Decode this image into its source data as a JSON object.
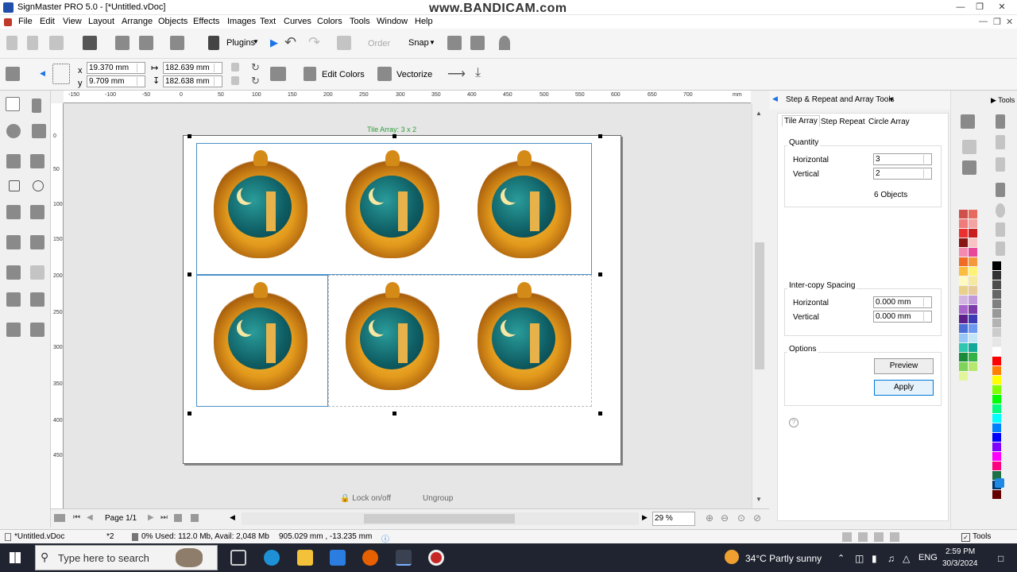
{
  "window": {
    "title": "SignMaster PRO 5.0 - [*Untitled.vDoc]",
    "watermark": "www.BANDICAM.com"
  },
  "menu": [
    "File",
    "Edit",
    "View",
    "Layout",
    "Arrange",
    "Objects",
    "Effects",
    "Images",
    "Text",
    "Curves",
    "Colors",
    "Tools",
    "Window",
    "Help"
  ],
  "toolbar": {
    "plugins": "Plugins",
    "order": "Order",
    "snap": "Snap",
    "x_label": "x",
    "y_label": "y",
    "x_value": "19.370 mm",
    "y_value": "9.709 mm",
    "width_value": "182.639 mm",
    "height_value": "182.638 mm",
    "edit_colors": "Edit Colors",
    "vectorize": "Vectorize"
  },
  "ruler": {
    "h_ticks": [
      "-150",
      "-100",
      "-50",
      "0",
      "50",
      "100",
      "150",
      "200",
      "250",
      "300",
      "350",
      "400",
      "450",
      "500",
      "550",
      "600",
      "650",
      "700"
    ],
    "h_unit": "mm",
    "v_ticks": [
      "0",
      "50",
      "100",
      "150",
      "200",
      "250",
      "300",
      "350",
      "400",
      "450"
    ]
  },
  "canvas": {
    "tile_label": "Tile Array: 3 x 2",
    "lock_label": "Lock on/off",
    "ungroup_label": "Ungroup"
  },
  "panel": {
    "header": "Step & Repeat and Array Tools",
    "tabs": [
      "Tile Array",
      "Step Repeat",
      "Circle Array"
    ],
    "quantity": {
      "title": "Quantity",
      "horizontal_label": "Horizontal",
      "horizontal_value": "3",
      "vertical_label": "Vertical",
      "vertical_value": "2",
      "objects": "6 Objects"
    },
    "spacing": {
      "title": "Inter-copy Spacing",
      "horizontal_label": "Horizontal",
      "horizontal_value": "0.000 mm",
      "vertical_label": "Vertical",
      "vertical_value": "0.000 mm"
    },
    "options": {
      "title": "Options",
      "preview": "Preview",
      "apply": "Apply"
    }
  },
  "right_panel": {
    "tools_label": "Tools"
  },
  "page_nav": {
    "page": "Page 1/1",
    "zoom": "29 %"
  },
  "status": {
    "doc": "*Untitled.vDoc",
    "count": "*2",
    "memory": "0%  Used: 112.0 Mb, Avail: 2,048 Mb",
    "coords": "905.029 mm , -13.235 mm",
    "tools": "Tools"
  },
  "taskbar": {
    "search_placeholder": "Type here to search",
    "weather": "34°C  Partly sunny",
    "lang": "ENG",
    "time": "2:59 PM",
    "date": "30/3/2024"
  },
  "palette_colors": [
    "#d0504c",
    "#e86a5e",
    "#f07b7b",
    "#f4a3a3",
    "#ec2f2f",
    "#c81e1e",
    "#8b1414",
    "#f9c3c3",
    "#f58ab0",
    "#e9479a",
    "#f06c26",
    "#f49a3b",
    "#fbbd3d",
    "#fff275",
    "#fff9c2",
    "#f5e9a1",
    "#e9d08b",
    "#e8c99a",
    "#d4b6e3",
    "#c198d9",
    "#a764c9",
    "#7a3aa8",
    "#5c1e8a",
    "#3b3bb6",
    "#4b6fd6",
    "#6d9af0",
    "#97c8f5",
    "#c2e6f8",
    "#2fc7b1",
    "#12a89a",
    "#1b8a3a",
    "#33b24a",
    "#7fd35b",
    "#b6e86f",
    "#e2f59b"
  ],
  "palette2_colors": [
    "#000000",
    "#333333",
    "#4d4d4d",
    "#666666",
    "#808080",
    "#999999",
    "#b3b3b3",
    "#cccccc",
    "#e6e6e6",
    "#ffffff",
    "#ff0000",
    "#ff7f00",
    "#ffff00",
    "#7fff00",
    "#00ff00",
    "#00ff7f",
    "#00ffff",
    "#007fff",
    "#0000ff",
    "#7f00ff",
    "#ff00ff",
    "#ff007f",
    "#1e7145",
    "#003366",
    "#660000"
  ]
}
